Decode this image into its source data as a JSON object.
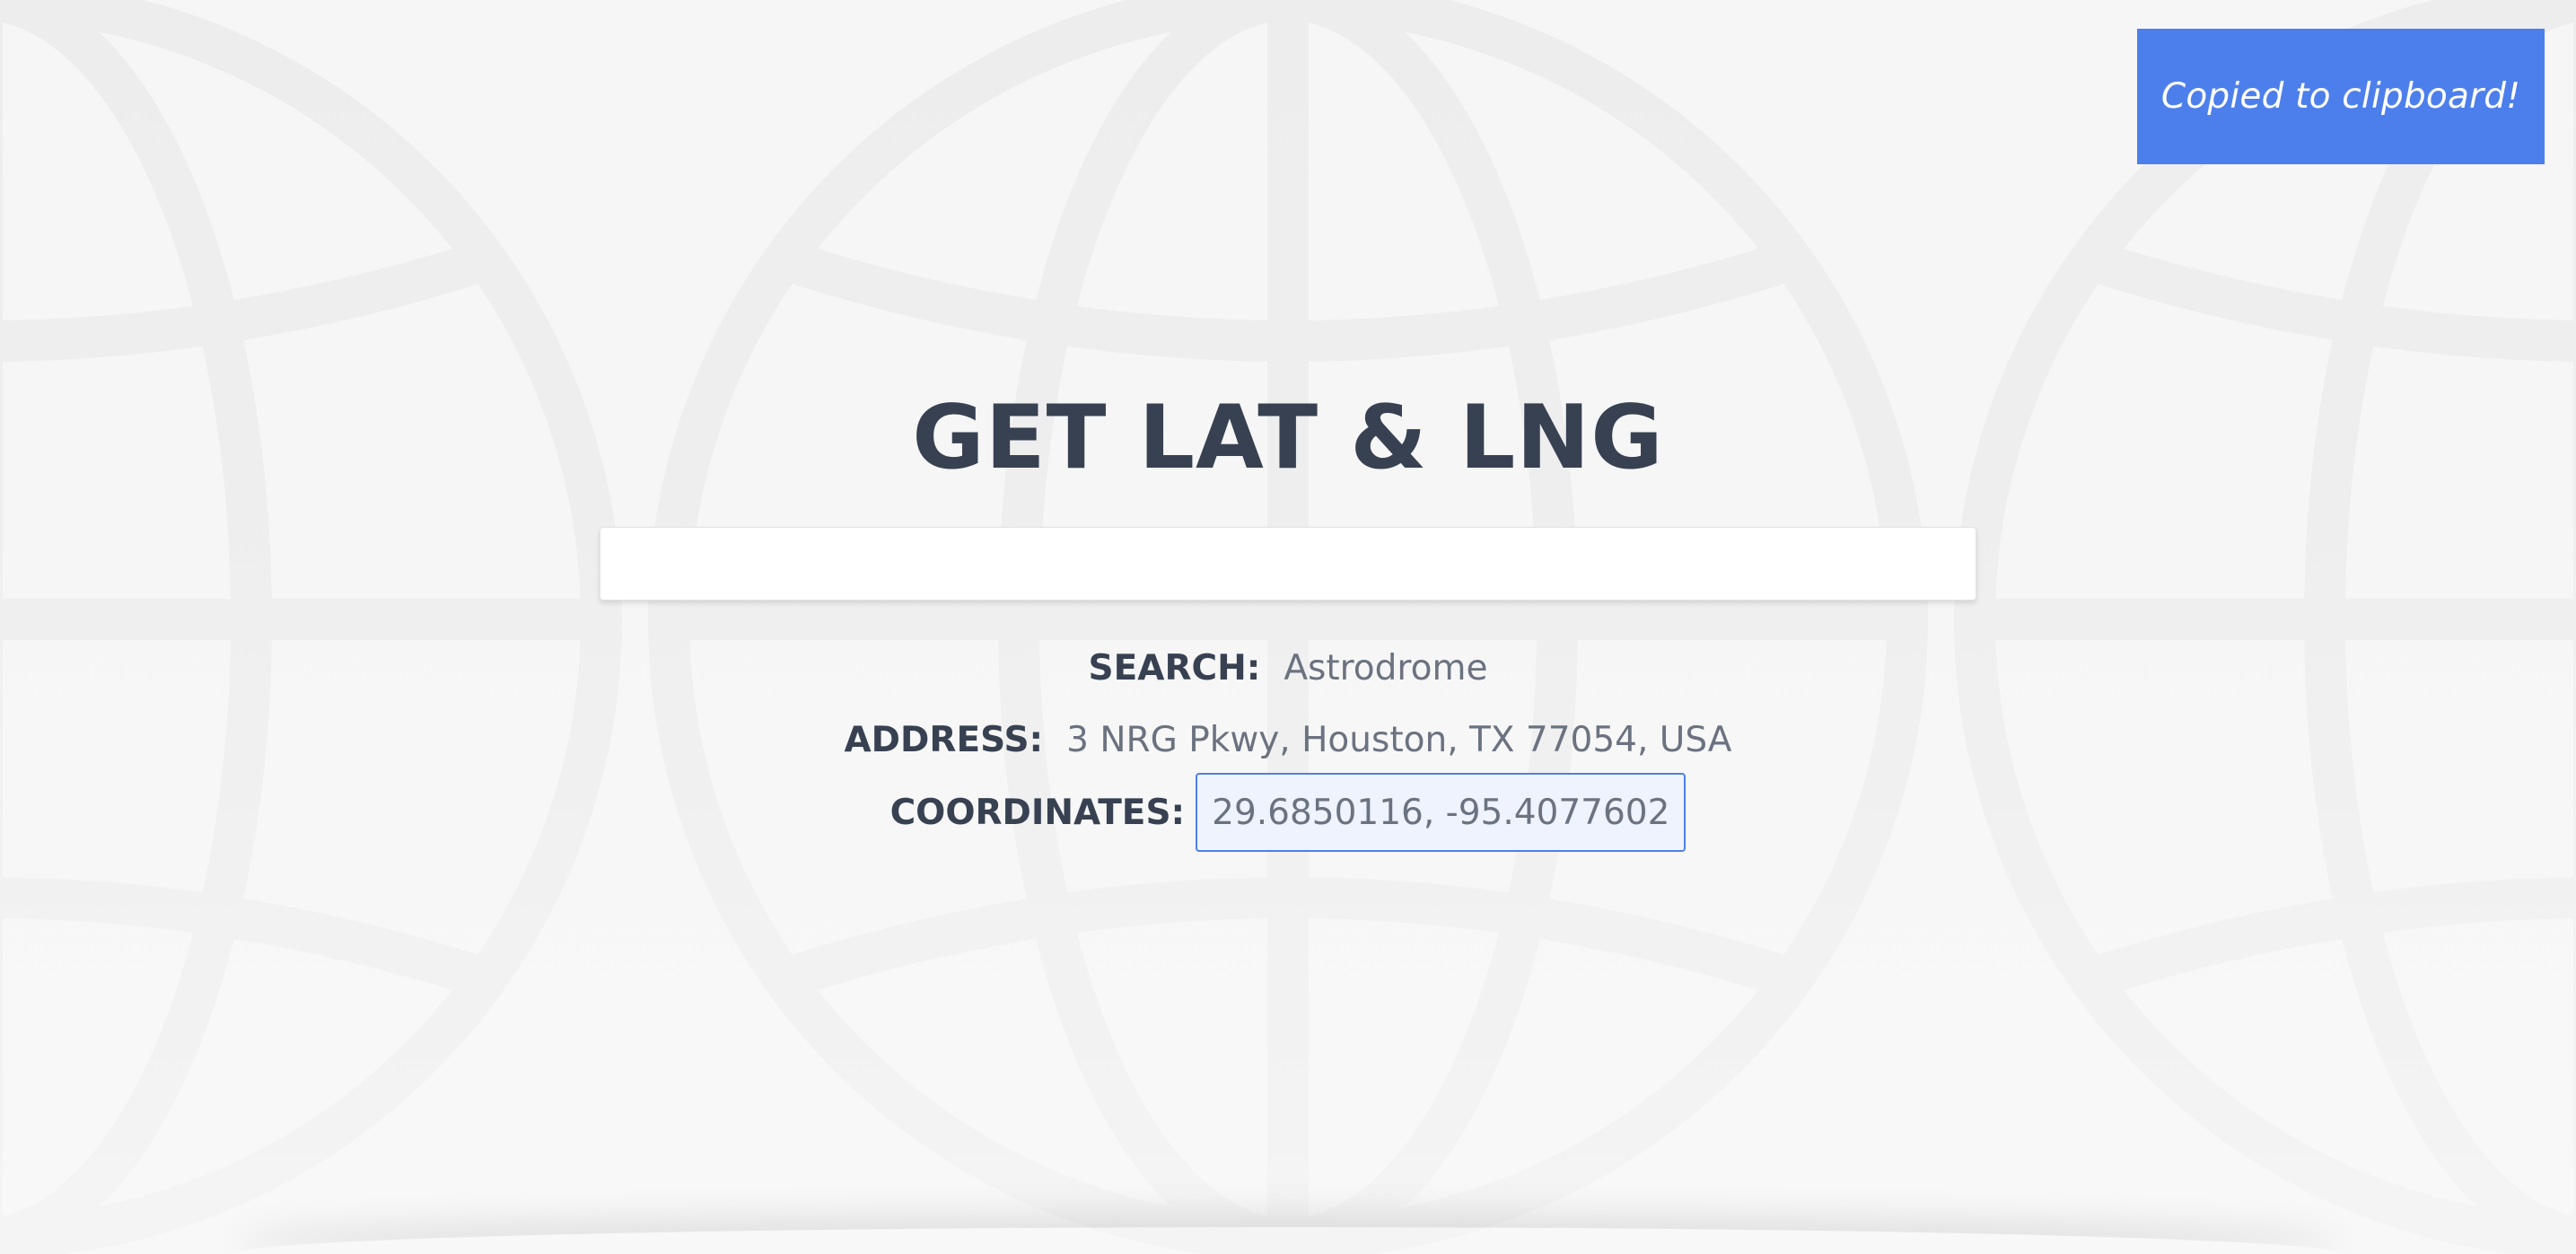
{
  "toast": {
    "message": "Copied to clipboard!"
  },
  "page": {
    "title": "GET LAT & LNG"
  },
  "search": {
    "value": "",
    "placeholder": ""
  },
  "result": {
    "search_label": "SEARCH:",
    "search_value": "Astrodrome",
    "address_label": "ADDRESS:",
    "address_value": "3 NRG Pkwy, Houston, TX 77054, USA",
    "coordinates_label": "COORDINATES:",
    "coordinates_value": "29.6850116, -95.4077602"
  },
  "colors": {
    "background": "#f6f6f6",
    "toast_bg": "#4d7fec",
    "heading_text": "#374151",
    "muted_text": "#6b7280",
    "highlight_border": "#4d7fec",
    "highlight_bg": "#eef3fe"
  },
  "icons": {
    "background_pattern": "globe-icon"
  }
}
